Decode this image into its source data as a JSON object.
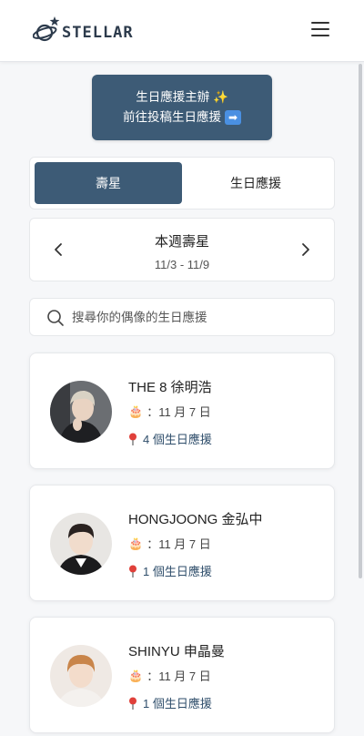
{
  "header": {
    "logo_text": "STELLAR",
    "menu_icon": "hamburger-icon"
  },
  "cta": {
    "line1": "生日應援主辦 ✨",
    "line2": "前往投稿生日應援",
    "arrow": "➡"
  },
  "tabs": [
    {
      "label": "壽星",
      "active": true
    },
    {
      "label": "生日應援",
      "active": false
    }
  ],
  "week": {
    "title": "本週壽星",
    "range": "11/3 - 11/9"
  },
  "search": {
    "placeholder": "搜尋你的偶像的生日應援"
  },
  "idols": [
    {
      "name": "THE 8 徐明浩",
      "birthday": "：11 月 7 日",
      "support_count": "4 個生日應援"
    },
    {
      "name": "HONGJOONG 金弘中",
      "birthday": "：11 月 7 日",
      "support_count": "1 個生日應援"
    },
    {
      "name": "SHINYU 申晶曼",
      "birthday": "：11 月 7 日",
      "support_count": "1 個生日應援"
    }
  ],
  "colors": {
    "primary": "#3d5b76",
    "accent_link": "#2f4e6b"
  }
}
